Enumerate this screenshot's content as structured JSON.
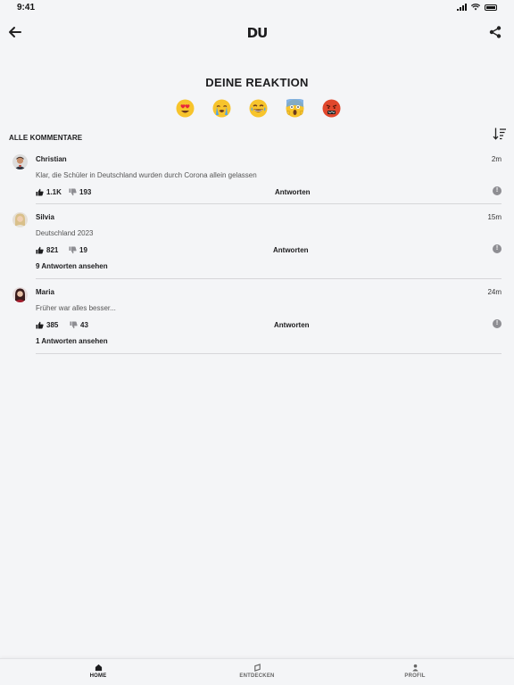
{
  "status": {
    "time": "9:41"
  },
  "header": {
    "logo": "DU"
  },
  "reactions": {
    "title": "DEINE REAKTION",
    "items": [
      "heart-eyes-emoji",
      "crying-emoji",
      "laughing-emoji",
      "screaming-emoji",
      "angry-emoji"
    ]
  },
  "comments_section": {
    "title": "ALLE KOMMENTARE"
  },
  "comments": [
    {
      "name": "Christian",
      "time": "2m",
      "text": "Klar, die Schüler in Deutschland wurden durch Corona allein gelassen",
      "likes": "1.1K",
      "dislikes": "193",
      "reply_label": "Antworten",
      "replies_label": ""
    },
    {
      "name": "Silvia",
      "time": "15m",
      "text": "Deutschland 2023",
      "likes": "821",
      "dislikes": "19",
      "reply_label": "Antworten",
      "replies_label": "9 Antworten ansehen"
    },
    {
      "name": "Maria",
      "time": "24m",
      "text": "Früher war alles besser...",
      "likes": "385",
      "dislikes": "43",
      "reply_label": "Antworten",
      "replies_label": "1 Antworten ansehen"
    }
  ],
  "tabs": [
    {
      "label": "HOME",
      "active": true
    },
    {
      "label": "ENTDECKEN",
      "active": false
    },
    {
      "label": "PROFIL",
      "active": false
    }
  ],
  "colors": {
    "background": "#f4f5f7",
    "text": "#1c1c1e",
    "divider": "#d6d6d9",
    "muted_icon": "#8e8e93"
  }
}
